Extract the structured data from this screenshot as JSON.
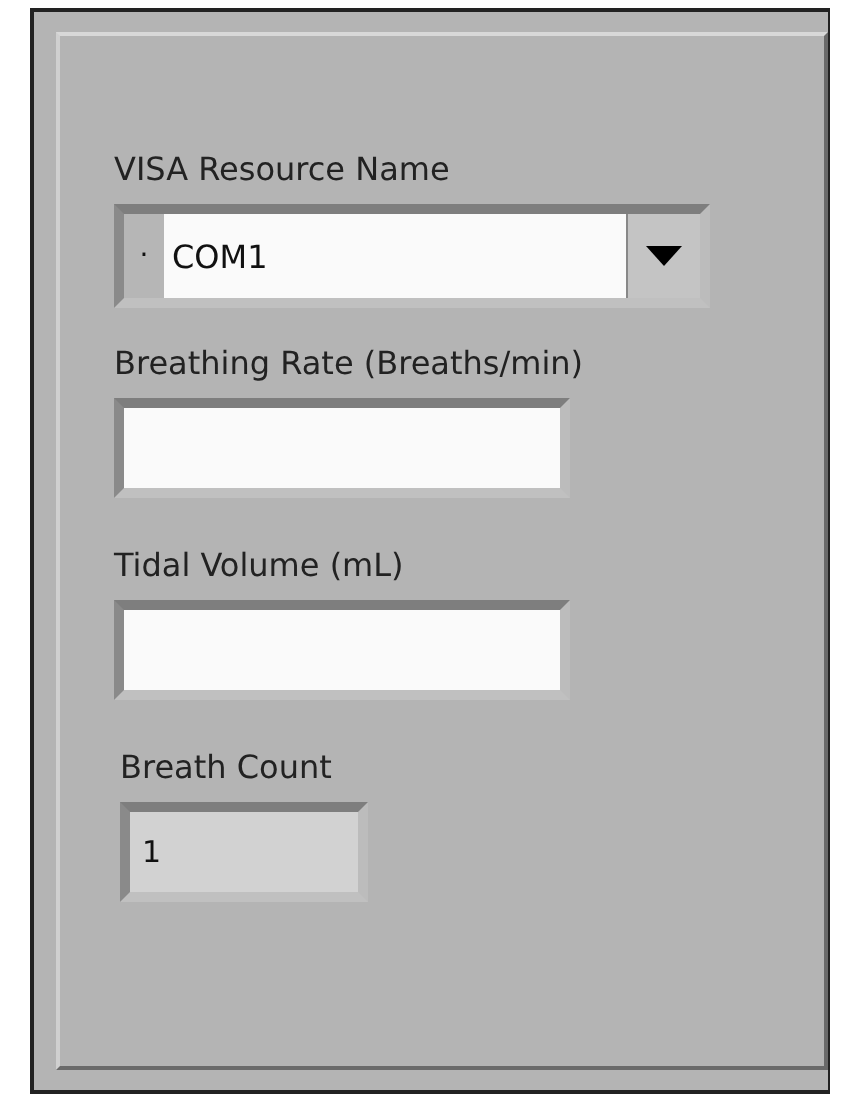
{
  "controls": [
    {
      "kind": "combo",
      "label": "VISA Resource Name",
      "value": "COM1",
      "prefix": "·"
    },
    {
      "kind": "input",
      "label": "Breathing Rate (Breaths/min)"
    },
    {
      "kind": "input",
      "label": "Tidal Volume (mL)"
    },
    {
      "kind": "indicator",
      "label": "Breath Count",
      "value": "1"
    }
  ]
}
